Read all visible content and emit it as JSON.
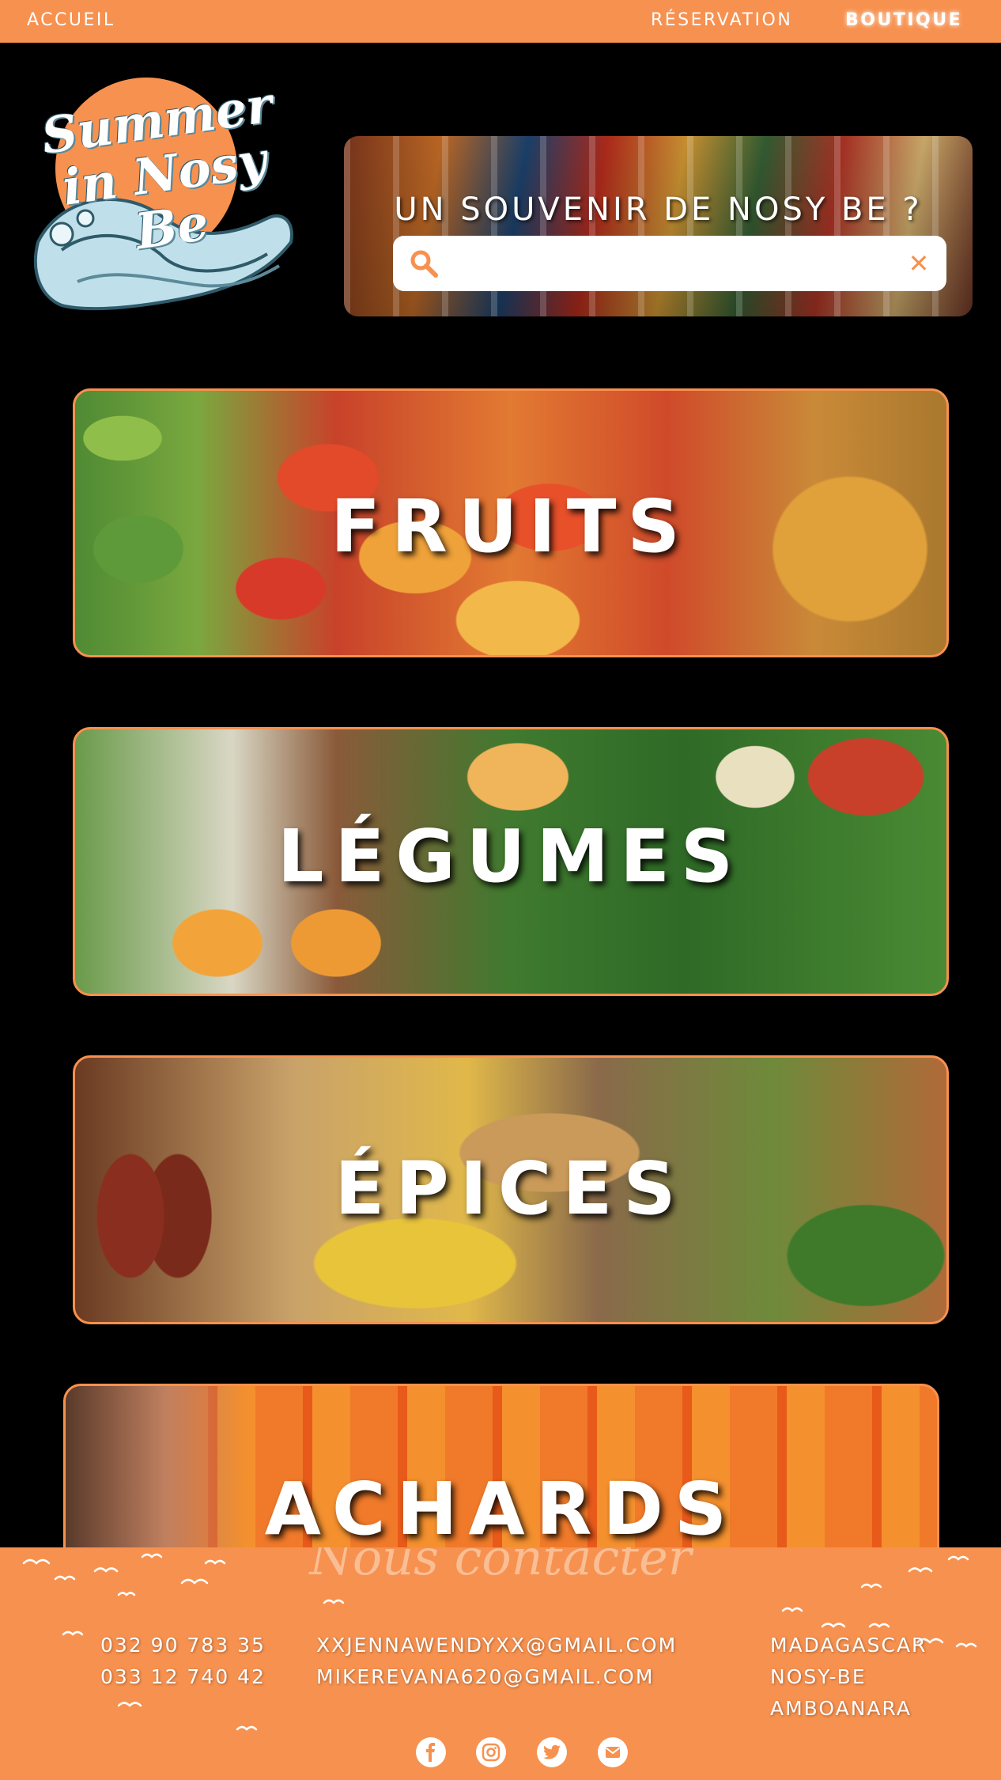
{
  "nav": {
    "home": "ACCUEIL",
    "reservation": "RÉSERVATION",
    "shop": "BOUTIQUE"
  },
  "logo": {
    "line1": "Summer",
    "line2": "in Nosy Be"
  },
  "search": {
    "title": "UN SOUVENIR DE NOSY BE ?",
    "value": "",
    "clear": "✕"
  },
  "categories": [
    {
      "label": "FRUITS"
    },
    {
      "label": "LÉGUMES"
    },
    {
      "label": "ÉPICES"
    },
    {
      "label": "ACHARDS"
    }
  ],
  "footer": {
    "title": "Nous contacter",
    "phones": [
      "032 90 783 35",
      "033 12 740 42"
    ],
    "emails": [
      "XXJENNAWENDYXX@GMAIL.COM",
      "MIKEREVANA620@GMAIL.COM"
    ],
    "address": [
      "MADAGASCAR",
      "NOSY-BE",
      "AMBOANARA"
    ],
    "socials": [
      "facebook-icon",
      "instagram-icon",
      "twitter-icon",
      "mail-icon"
    ]
  },
  "colors": {
    "accent": "#f7914f",
    "background": "#000000",
    "text": "#ffffff"
  }
}
